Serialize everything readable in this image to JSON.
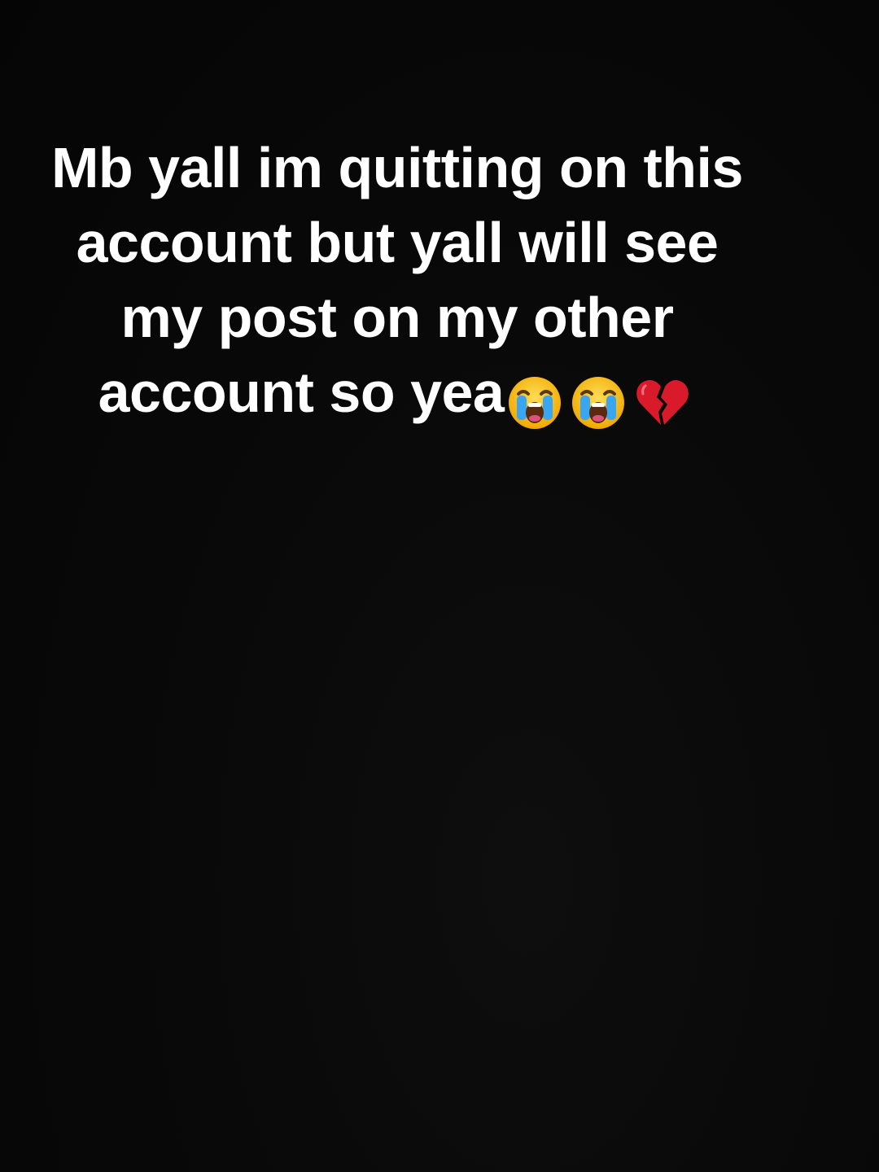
{
  "caption": {
    "lines": [
      "Mb yall im quitting on this",
      "account but yall will see",
      "my post on my other",
      "account so yea"
    ],
    "emojis": [
      "loudly-crying-face-icon",
      "loudly-crying-face-icon",
      "broken-heart-icon"
    ]
  },
  "colors": {
    "background": "#050505",
    "text": "#ffffff"
  }
}
